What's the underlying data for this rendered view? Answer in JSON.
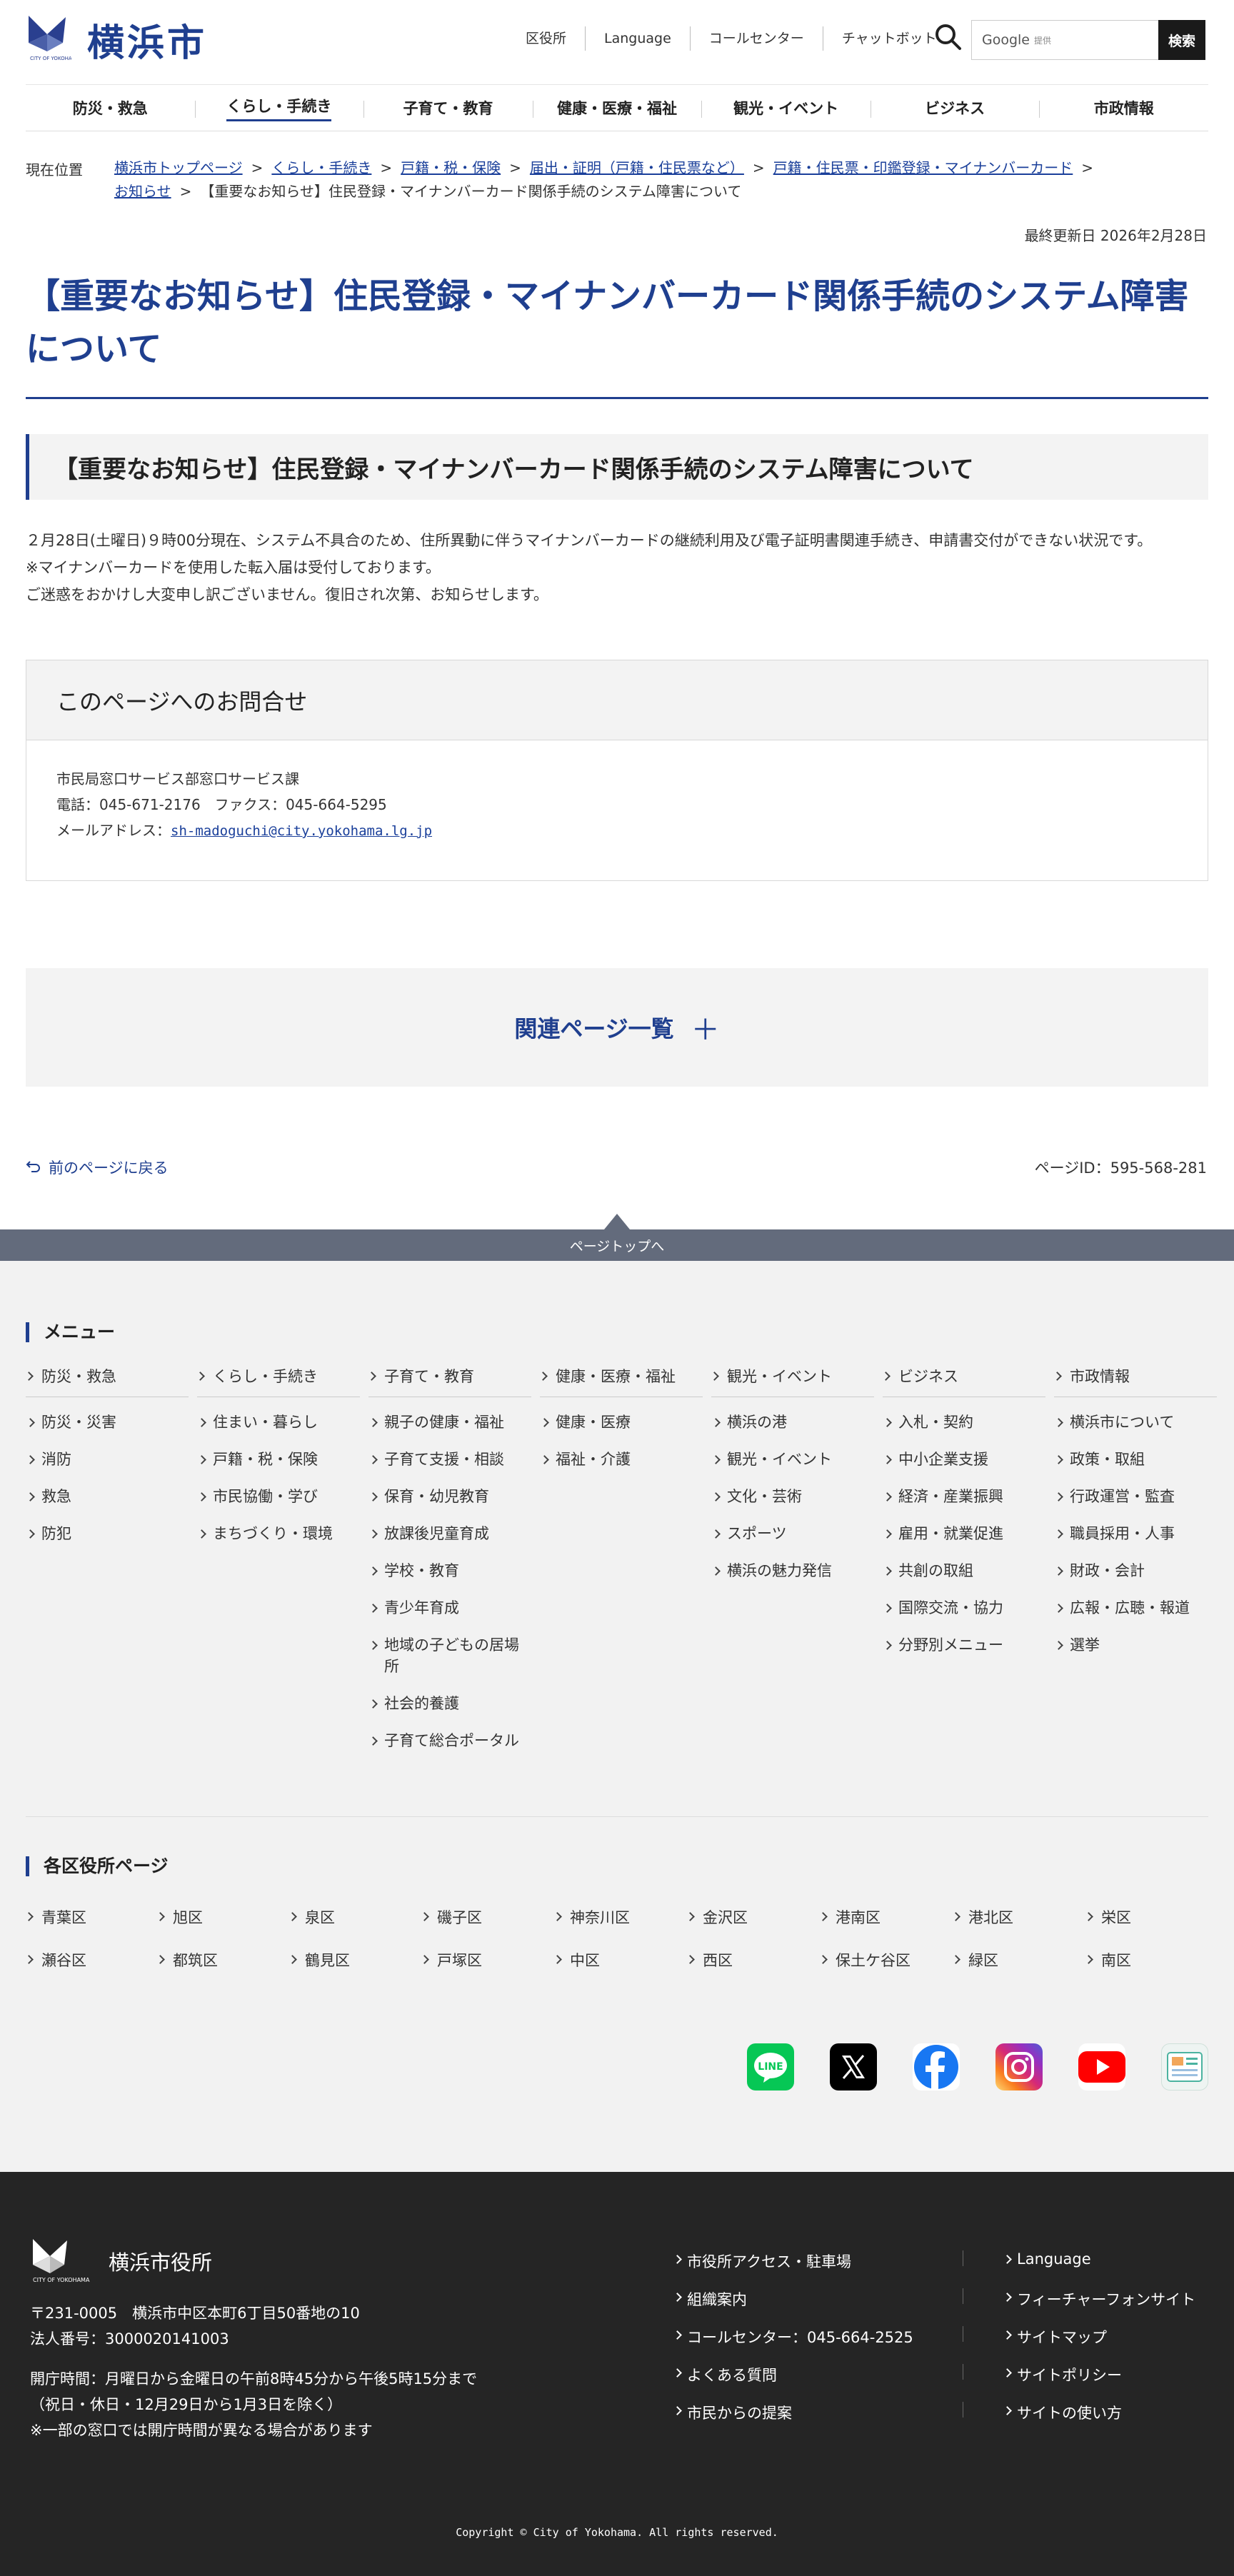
{
  "header": {
    "logo_text": "横浜市",
    "logo_sub": "CITY OF YOKOHAMA",
    "util_links": [
      "区役所",
      "Language",
      "コールセンター",
      "チャットボット"
    ],
    "search_google": "Google",
    "search_provided": "提供",
    "search_button": "検索"
  },
  "gnav": [
    "防災・救急",
    "くらし・手続き",
    "子育て・教育",
    "健康・医療・福祉",
    "観光・イベント",
    "ビジネス",
    "市政情報"
  ],
  "breadcrumb": {
    "label": "現在位置",
    "items": [
      "横浜市トップページ",
      "くらし・手続き",
      "戸籍・税・保険",
      "届出・証明（戸籍・住民票など）",
      "戸籍・住民票・印鑑登録・マイナンバーカード",
      "お知らせ"
    ],
    "current": "【重要なお知らせ】住民登録・マイナンバーカード関係手続のシステム障害について"
  },
  "updated": "最終更新日 2026年2月28日",
  "title": "【重要なお知らせ】住民登録・マイナンバーカード関係手続のシステム障害について",
  "notice_heading": "【重要なお知らせ】住民登録・マイナンバーカード関係手続のシステム障害について",
  "body": [
    "２月28日(土曜日)９時00分現在、システム不具合のため、住所異動に伴うマイナンバーカードの継続利用及び電子証明書関連手続き、申請書交付ができない状況です。",
    "※マイナンバーカードを使用した転入届は受付しております。",
    "ご迷惑をおかけし大変申し訳ございません。復旧され次第、お知らせします。"
  ],
  "contact": {
    "heading": "このページへのお問合せ",
    "dept": "市民局窓口サービス部窓口サービス課",
    "phone": "電話：045-671-2176　ファクス：045-664-5295",
    "mail_label": "メールアドレス：",
    "mail": "sh-madoguchi@city.yokohama.lg.jp"
  },
  "related": "関連ページ一覧",
  "back": "前のページに戻る",
  "page_id": "ページID：595-568-281",
  "to_top": "ページトップへ",
  "footer_menu": {
    "heading": "メニュー",
    "columns": [
      {
        "title": "防災・救急",
        "items": [
          "防災・災害",
          "消防",
          "救急",
          "防犯"
        ]
      },
      {
        "title": "くらし・手続き",
        "items": [
          "住まい・暮らし",
          "戸籍・税・保険",
          "市民協働・学び",
          "まちづくり・環境"
        ]
      },
      {
        "title": "子育て・教育",
        "items": [
          "親子の健康・福祉",
          "子育て支援・相談",
          "保育・幼児教育",
          "放課後児童育成",
          "学校・教育",
          "青少年育成",
          "地域の子どもの居場所",
          "社会的養護",
          "子育て総合ポータル"
        ]
      },
      {
        "title": "健康・医療・福祉",
        "items": [
          "健康・医療",
          "福祉・介護"
        ]
      },
      {
        "title": "観光・イベント",
        "items": [
          "横浜の港",
          "観光・イベント",
          "文化・芸術",
          "スポーツ",
          "横浜の魅力発信"
        ]
      },
      {
        "title": "ビジネス",
        "items": [
          "入札・契約",
          "中小企業支援",
          "経済・産業振興",
          "雇用・就業促進",
          "共創の取組",
          "国際交流・協力",
          "分野別メニュー"
        ]
      },
      {
        "title": "市政情報",
        "items": [
          "横浜市について",
          "政策・取組",
          "行政運営・監査",
          "職員採用・人事",
          "財政・会計",
          "広報・広聴・報道",
          "選挙"
        ]
      }
    ]
  },
  "wards": {
    "heading": "各区役所ページ",
    "row1": [
      "青葉区",
      "旭区",
      "泉区",
      "磯子区",
      "神奈川区",
      "金沢区",
      "港南区",
      "港北区",
      "栄区"
    ],
    "row2": [
      "瀬谷区",
      "都筑区",
      "鶴見区",
      "戸塚区",
      "中区",
      "西区",
      "保土ケ谷区",
      "緑区",
      "南区"
    ]
  },
  "social": [
    {
      "name": "line-icon",
      "color": "#06c755"
    },
    {
      "name": "x-icon",
      "color": "#000000"
    },
    {
      "name": "facebook-icon",
      "color": "#1877f2"
    },
    {
      "name": "instagram-icon",
      "color": "#d6249f"
    },
    {
      "name": "youtube-icon",
      "color": "#ff0000"
    },
    {
      "name": "news-app-icon",
      "color": "#e8f0ee"
    }
  ],
  "dark_footer": {
    "name": "横浜市役所",
    "address": "〒231-0005　横浜市中区本町6丁目50番地の10",
    "corp_no": "法人番号：3000020141003",
    "hours1": "開庁時間：月曜日から金曜日の午前8時45分から午後5時15分まで",
    "hours2": "（祝日・休日・12月29日から1月3日を除く）",
    "hours3": "※一部の窓口では開庁時間が異なる場合があります",
    "links_left": [
      "市役所アクセス・駐車場",
      "組織案内",
      "コールセンター：045-664-2525",
      "よくある質問",
      "市民からの提案"
    ],
    "links_right": [
      "Language",
      "フィーチャーフォンサイト",
      "サイトマップ",
      "サイトポリシー",
      "サイトの使い方"
    ],
    "copyright": "Copyright © City of Yokohama. All rights reserved."
  },
  "colors": {
    "accent": "#1f3f8f",
    "link": "#1a3f9a",
    "footer_bg": "#252525",
    "to_top_bar": "#636b7c"
  }
}
